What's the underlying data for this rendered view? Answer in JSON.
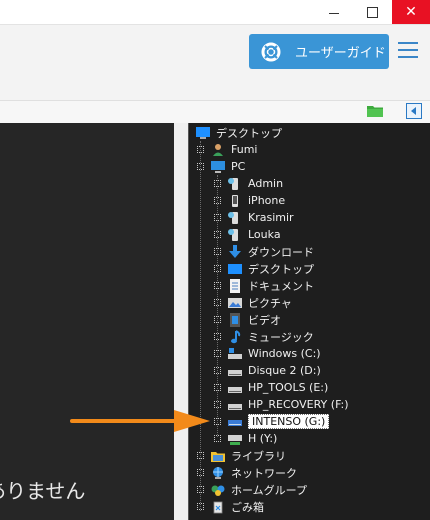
{
  "window": {
    "minimize_label": "—",
    "maximize_label": "",
    "close_label": "✕"
  },
  "toolbar": {
    "guide_button": "ユーザーガイド"
  },
  "main": {
    "visible_text": "ありません"
  },
  "tree": {
    "root": "デスクトップ",
    "items": [
      {
        "label": "Fumi",
        "icon": "user-icon"
      },
      {
        "label": "PC",
        "icon": "pc-icon"
      },
      {
        "label": "Admin",
        "icon": "device-icon"
      },
      {
        "label": "iPhone",
        "icon": "phone-icon"
      },
      {
        "label": "Krasimir",
        "icon": "device-icon"
      },
      {
        "label": "Louka",
        "icon": "device-icon"
      },
      {
        "label": "ダウンロード",
        "icon": "download-icon"
      },
      {
        "label": "デスクトップ",
        "icon": "desktop-icon"
      },
      {
        "label": "ドキュメント",
        "icon": "document-icon"
      },
      {
        "label": "ピクチャ",
        "icon": "pictures-icon"
      },
      {
        "label": "ビデオ",
        "icon": "video-icon"
      },
      {
        "label": "ミュージック",
        "icon": "music-icon"
      },
      {
        "label": "Windows (C:)",
        "icon": "system-drive-icon"
      },
      {
        "label": "Disque 2 (D:)",
        "icon": "drive-icon"
      },
      {
        "label": "HP_TOOLS (E:)",
        "icon": "drive-icon"
      },
      {
        "label": "HP_RECOVERY (F:)",
        "icon": "drive-icon"
      },
      {
        "label": "INTENSO (G:)",
        "icon": "usb-drive-icon",
        "selected": true
      },
      {
        "label": "H (Y:)",
        "icon": "network-drive-icon"
      },
      {
        "label": "ライブラリ",
        "icon": "library-icon"
      },
      {
        "label": "ネットワーク",
        "icon": "network-icon"
      },
      {
        "label": "ホームグループ",
        "icon": "homegroup-icon"
      },
      {
        "label": "ごみ箱",
        "icon": "recycle-bin-icon"
      }
    ]
  },
  "colors": {
    "accent": "#3a95d6",
    "close": "#e81123",
    "arrow": "#f28a1a",
    "tree_bg": "#1e1e1e",
    "main_bg": "#262626"
  }
}
